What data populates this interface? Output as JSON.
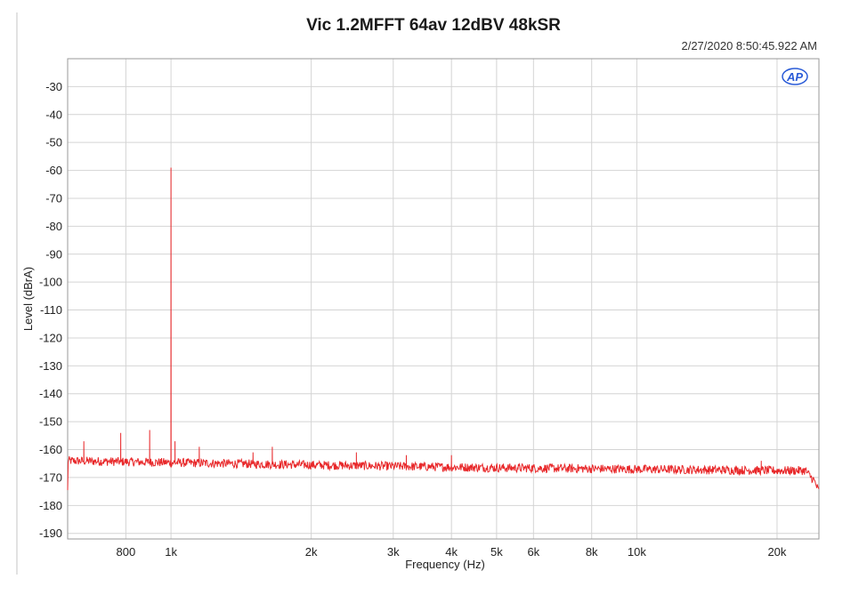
{
  "chart_data": {
    "type": "line",
    "title": "Vic 1.2MFFT 64av 12dBV 48kSR",
    "timestamp": "2/27/2020 8:50:45.922 AM",
    "logo": "AP",
    "xlabel": "Frequency (Hz)",
    "ylabel": "Level (dBrA)",
    "x_scale": "log",
    "xlim": [
      600,
      24600
    ],
    "ylim": [
      -192,
      -20
    ],
    "x_ticks": [
      {
        "value": 800,
        "label": "800"
      },
      {
        "value": 1000,
        "label": "1k"
      },
      {
        "value": 2000,
        "label": "2k"
      },
      {
        "value": 3000,
        "label": "3k"
      },
      {
        "value": 4000,
        "label": "4k"
      },
      {
        "value": 5000,
        "label": "5k"
      },
      {
        "value": 6000,
        "label": "6k"
      },
      {
        "value": 8000,
        "label": "8k"
      },
      {
        "value": 10000,
        "label": "10k"
      },
      {
        "value": 20000,
        "label": "20k"
      }
    ],
    "y_ticks": [
      {
        "value": -30,
        "label": "-30"
      },
      {
        "value": -40,
        "label": "-40"
      },
      {
        "value": -50,
        "label": "-50"
      },
      {
        "value": -60,
        "label": "-60"
      },
      {
        "value": -70,
        "label": "-70"
      },
      {
        "value": -80,
        "label": "-80"
      },
      {
        "value": -90,
        "label": "-90"
      },
      {
        "value": -100,
        "label": "-100"
      },
      {
        "value": -110,
        "label": "-110"
      },
      {
        "value": -120,
        "label": "-120"
      },
      {
        "value": -130,
        "label": "-130"
      },
      {
        "value": -140,
        "label": "-140"
      },
      {
        "value": -150,
        "label": "-150"
      },
      {
        "value": -160,
        "label": "-160"
      },
      {
        "value": -170,
        "label": "-170"
      },
      {
        "value": -180,
        "label": "-180"
      },
      {
        "value": -190,
        "label": "-190"
      }
    ],
    "grid": true,
    "series": [
      {
        "color": "#e8282a",
        "noise_floor": [
          [
            600,
            -164
          ],
          [
            2000,
            -165.5
          ],
          [
            5000,
            -166.5
          ],
          [
            10000,
            -167
          ],
          [
            20000,
            -167.5
          ],
          [
            23000,
            -167.5
          ],
          [
            24000,
            -171
          ],
          [
            24600,
            -175
          ]
        ],
        "peaks": [
          {
            "x": 650,
            "y": -157
          },
          {
            "x": 780,
            "y": -154
          },
          {
            "x": 900,
            "y": -153
          },
          {
            "x": 1000,
            "y": -59
          },
          {
            "x": 1020,
            "y": -157
          },
          {
            "x": 1150,
            "y": -159
          },
          {
            "x": 1500,
            "y": -161
          },
          {
            "x": 1650,
            "y": -159
          },
          {
            "x": 2500,
            "y": -161
          },
          {
            "x": 3200,
            "y": -162
          },
          {
            "x": 4000,
            "y": -162
          },
          {
            "x": 18500,
            "y": -164
          }
        ]
      }
    ]
  }
}
